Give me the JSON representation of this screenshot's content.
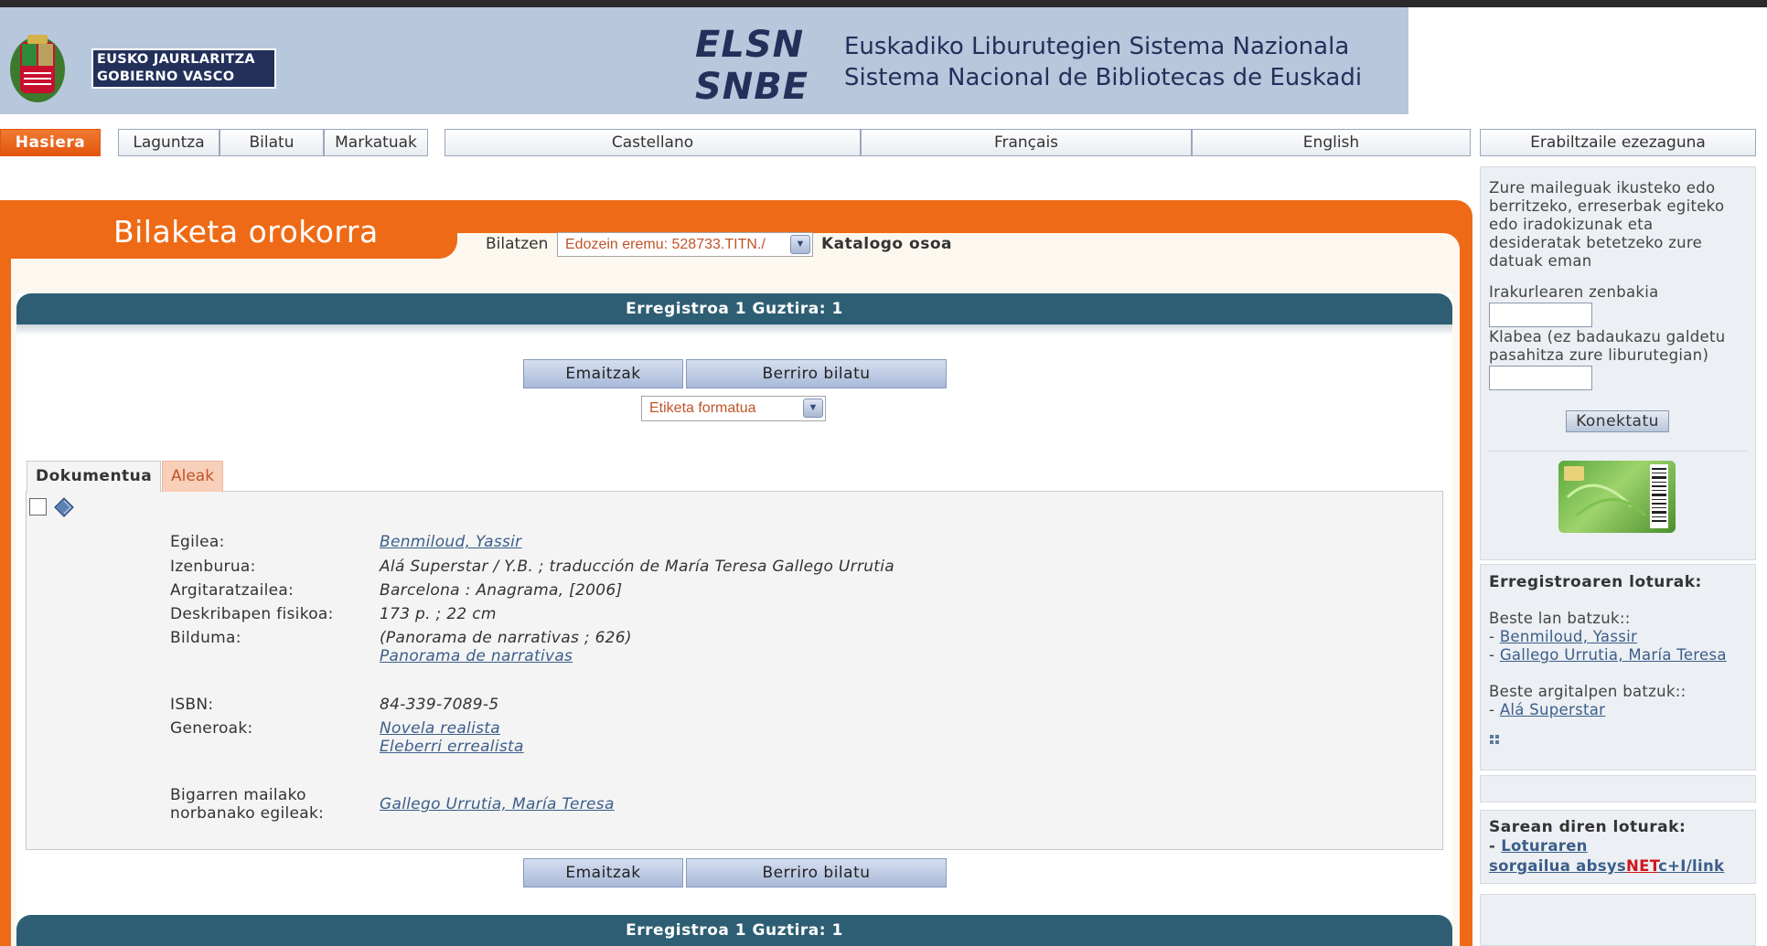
{
  "header": {
    "gov_line1": "EUSKO JAURLARITZA",
    "gov_line2": "GOBIERNO VASCO",
    "logo_line1": "ELSN",
    "logo_line2": "SNBE",
    "title_eu": "Euskadiko Liburutegien Sistema Nazionala",
    "title_es": "Sistema Nacional de Bibliotecas de Euskadi"
  },
  "nav": {
    "home": "Hasiera",
    "help": "Laguntza",
    "search": "Bilatu",
    "marked": "Markatuak",
    "lang_es": "Castellano",
    "lang_fr": "Français",
    "lang_en": "English",
    "user": "Erabiltzaile ezezaguna"
  },
  "main": {
    "title": "Bilaketa orokorra",
    "search_label": "Bilatzen",
    "search_value": "Edozein eremu: 528733.TITN./",
    "search_scope": "Katalogo osoa",
    "record_bar": "Erregistroa 1 Guztira: 1",
    "results_button": "Emaitzak",
    "research_button": "Berriro bilatu",
    "format_value": "Etiketa formatua",
    "tab_document": "Dokumentua",
    "tab_copies": "Aleak"
  },
  "record": {
    "author_label": "Egilea:",
    "author": "Benmiloud, Yassir",
    "title_label": "Izenburua:",
    "title": "Alá Superstar / Y.B. ; traducción de María Teresa Gallego Urrutia",
    "publisher_label": "Argitaratzailea:",
    "publisher": "Barcelona : Anagrama, [2006]",
    "physical_label": "Deskribapen fisikoa:",
    "physical": "173 p. ; 22 cm",
    "series_label": "Bilduma:",
    "series": "(Panorama de narrativas ; 626)",
    "series_link": "Panorama de narrativas",
    "isbn_label": "ISBN:",
    "isbn": "84-339-7089-5",
    "genres_label": "Generoak:",
    "genre1": "Novela realista",
    "genre2": "Eleberri errealista",
    "secondary_label_1": "Bigarren mailako",
    "secondary_label_2": "norbanako egileak:",
    "secondary": "Gallego Urrutia, María Teresa"
  },
  "sidebar": {
    "login_text": [
      "Zure maileguak ikusteko edo",
      "berritzeko, erreserbak egiteko",
      "edo iradokizunak eta",
      "desideratak betetzeko zure",
      "datuak eman"
    ],
    "reader_label": "Irakurlearen zenbakia",
    "password_label_1": "Klabea (ez badaukazu galdetu",
    "password_label_2": "pasahitza zure liburutegian)",
    "connect_button": "Konektatu",
    "links_title": "Erregistroaren loturak:",
    "other_works": "Beste lan batzuk::",
    "link_author1": "Benmiloud, Yassir",
    "link_author2": "Gallego Urrutia, María Teresa",
    "other_editions": "Beste argitalpen batzuk::",
    "link_edition": "Alá Superstar",
    "net_title": "Sarean diren loturak:",
    "net_link_1": "Loturaren",
    "net_link_2a": "sorgailua absys",
    "net_link_2b": "NET",
    "net_link_2c": "c+I/link",
    "dash": "- "
  },
  "colors": {
    "accent_orange": "#ef6a16",
    "bar_teal": "#2e5e74",
    "banner_blue": "#b7c7dc",
    "link_blue": "#3b5e8a"
  }
}
